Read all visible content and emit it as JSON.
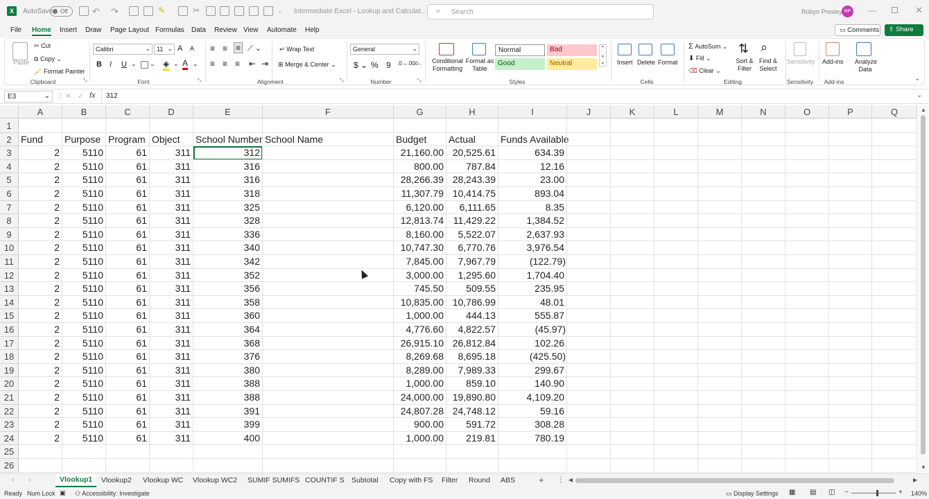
{
  "title": {
    "autosave_label": "AutoSave",
    "autosave_state": "Off",
    "doc_title": "Intermediate Excel - Lookup and Calculat...",
    "search_placeholder": "Search",
    "user_name": "Robyn Presley",
    "user_initials": "RP"
  },
  "ribbon_tabs": [
    "File",
    "Home",
    "Insert",
    "Draw",
    "Page Layout",
    "Formulas",
    "Data",
    "Review",
    "View",
    "Automate",
    "Help"
  ],
  "active_tab": "Home",
  "comments_label": "Comments",
  "share_label": "Share",
  "clipboard": {
    "paste": "Paste",
    "cut": "Cut",
    "copy": "Copy",
    "format_painter": "Format Painter",
    "group": "Clipboard"
  },
  "font": {
    "name": "Calibri",
    "size": "11",
    "group": "Font",
    "bold": "B",
    "italic": "I",
    "underline": "U",
    "grow": "A",
    "shrink": "A"
  },
  "alignment": {
    "wrap": "Wrap Text",
    "merge": "Merge & Center",
    "group": "Alignment"
  },
  "number": {
    "format": "General",
    "currency": "$",
    "percent": "%",
    "comma": "9",
    "group": "Number"
  },
  "styles": {
    "conditional": "Conditional Formatting",
    "format_table": "Format as Table",
    "normal": "Normal",
    "bad": "Bad",
    "good": "Good",
    "neutral": "Neutral",
    "group": "Styles"
  },
  "cells": {
    "insert": "Insert",
    "delete": "Delete",
    "format": "Format",
    "group": "Cells"
  },
  "editing": {
    "autosum": "AutoSum",
    "fill": "Fill",
    "clear": "Clear",
    "sort": "Sort & Filter",
    "find": "Find & Select",
    "group": "Editing"
  },
  "sensitivity": {
    "label": "Sensitivity",
    "group": "Sensitivity"
  },
  "addins": {
    "label": "Add-ins",
    "analyze": "Analyze Data",
    "group": "Add-ins"
  },
  "formula_bar": {
    "name_box": "E3",
    "fx": "fx",
    "value": "312"
  },
  "columns": [
    "A",
    "B",
    "C",
    "D",
    "E",
    "F",
    "G",
    "H",
    "I",
    "J",
    "K",
    "L",
    "M",
    "N",
    "O",
    "P",
    "Q"
  ],
  "row_numbers": [
    "1",
    "2",
    "3",
    "4",
    "5",
    "6",
    "7",
    "8",
    "9",
    "10",
    "11",
    "12",
    "13",
    "14",
    "15",
    "16",
    "17",
    "18",
    "19",
    "20",
    "21",
    "22",
    "23",
    "24",
    "25",
    "26"
  ],
  "headers": [
    "Fund",
    "Purpose",
    "Program",
    "Object",
    "School Number",
    "School Name",
    "Budget",
    "Actual",
    "Funds Available"
  ],
  "rows": [
    [
      "2",
      "5110",
      "61",
      "311",
      "312",
      "",
      "21,160.00",
      "20,525.61",
      "634.39"
    ],
    [
      "2",
      "5110",
      "61",
      "311",
      "316",
      "",
      "800.00",
      "787.84",
      "12.16"
    ],
    [
      "2",
      "5110",
      "61",
      "311",
      "316",
      "",
      "28,266.39",
      "28,243.39",
      "23.00"
    ],
    [
      "2",
      "5110",
      "61",
      "311",
      "318",
      "",
      "11,307.79",
      "10,414.75",
      "893.04"
    ],
    [
      "2",
      "5110",
      "61",
      "311",
      "325",
      "",
      "6,120.00",
      "6,111.65",
      "8.35"
    ],
    [
      "2",
      "5110",
      "61",
      "311",
      "328",
      "",
      "12,813.74",
      "11,429.22",
      "1,384.52"
    ],
    [
      "2",
      "5110",
      "61",
      "311",
      "336",
      "",
      "8,160.00",
      "5,522.07",
      "2,637.93"
    ],
    [
      "2",
      "5110",
      "61",
      "311",
      "340",
      "",
      "10,747.30",
      "6,770.76",
      "3,976.54"
    ],
    [
      "2",
      "5110",
      "61",
      "311",
      "342",
      "",
      "7,845.00",
      "7,967.79",
      "(122.79)"
    ],
    [
      "2",
      "5110",
      "61",
      "311",
      "352",
      "",
      "3,000.00",
      "1,295.60",
      "1,704.40"
    ],
    [
      "2",
      "5110",
      "61",
      "311",
      "356",
      "",
      "745.50",
      "509.55",
      "235.95"
    ],
    [
      "2",
      "5110",
      "61",
      "311",
      "358",
      "",
      "10,835.00",
      "10,786.99",
      "48.01"
    ],
    [
      "2",
      "5110",
      "61",
      "311",
      "360",
      "",
      "1,000.00",
      "444.13",
      "555.87"
    ],
    [
      "2",
      "5110",
      "61",
      "311",
      "364",
      "",
      "4,776.60",
      "4,822.57",
      "(45.97)"
    ],
    [
      "2",
      "5110",
      "61",
      "311",
      "368",
      "",
      "26,915.10",
      "26,812.84",
      "102.26"
    ],
    [
      "2",
      "5110",
      "61",
      "311",
      "376",
      "",
      "8,269.68",
      "8,695.18",
      "(425.50)"
    ],
    [
      "2",
      "5110",
      "61",
      "311",
      "380",
      "",
      "8,289.00",
      "7,989.33",
      "299.67"
    ],
    [
      "2",
      "5110",
      "61",
      "311",
      "388",
      "",
      "1,000.00",
      "859.10",
      "140.90"
    ],
    [
      "2",
      "5110",
      "61",
      "311",
      "388",
      "",
      "24,000.00",
      "19,890.80",
      "4,109.20"
    ],
    [
      "2",
      "5110",
      "61",
      "311",
      "391",
      "",
      "24,807.28",
      "24,748.12",
      "59.16"
    ],
    [
      "2",
      "5110",
      "61",
      "311",
      "399",
      "",
      "900.00",
      "591.72",
      "308.28"
    ],
    [
      "2",
      "5110",
      "61",
      "311",
      "400",
      "",
      "1,000.00",
      "219.81",
      "780.19"
    ]
  ],
  "sheet_tabs": [
    "Vlookup1",
    "Vlookup2",
    "Vlookup WC",
    "Vlookup WC2",
    "SUMIF SUMIFS",
    "COUNTIF S",
    "Subtotal",
    "Copy with FS",
    "Filter",
    "Round",
    "ABS"
  ],
  "active_sheet": "Vlookup1",
  "status": {
    "ready": "Ready",
    "numlock": "Num Lock",
    "accessibility": "Accessibility: Investigate",
    "display": "Display Settings",
    "zoom": "140%"
  },
  "colors": {
    "excel_green": "#107c41",
    "share_green": "#0f7b3f",
    "avatar": "#c239b3",
    "bad_bg": "#ffc7ce",
    "bad_fg": "#9c0006",
    "good_bg": "#c6efce",
    "good_fg": "#006100",
    "neutral_bg": "#ffeb9c",
    "neutral_fg": "#9c5700"
  }
}
